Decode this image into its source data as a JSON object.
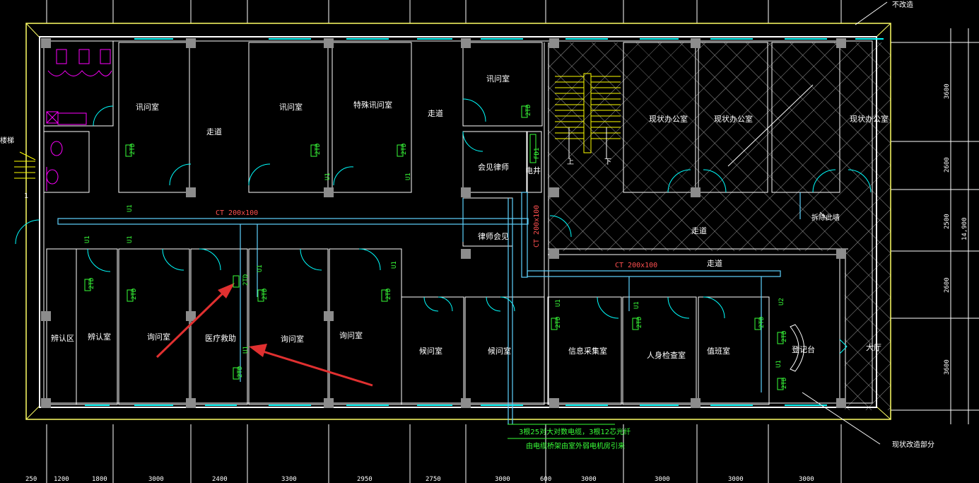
{
  "colors": {
    "wall": "#ffffff",
    "outline": "#ffff66",
    "cable": "#5fd3ff",
    "cable_label": "#ff5050",
    "terminal": "#39ff39",
    "door": "#00ffff",
    "hatch": "#9a9a9a",
    "column": "#8c8c8c",
    "toilet": "#ff00ff",
    "stair": "#ffff00",
    "arrow": "#e03030"
  },
  "labels": {
    "not_renovated": "不改造",
    "stair_left": "楼梯",
    "renovate_part": "现状改造部分",
    "demolish": "拆除此墙",
    "up": "上",
    "down": "下",
    "one": "1"
  },
  "rooms": {
    "interrogation_1": "讯问室",
    "corridor_1": "走道",
    "interrogation_2": "讯问室",
    "special_interrogation": "特殊讯问室",
    "corridor_2": "走道",
    "interrogation_3": "讯问室",
    "lawyer_meet": "会见律师",
    "elec_shaft": "电井",
    "lawyer_meeting": "律师会见",
    "office_1": "现状办公室",
    "office_2": "现状办公室",
    "office_3": "现状办公室",
    "corridor_3": "走道",
    "corridor_4": "走道",
    "identification_area": "辨认区",
    "identification_room": "辨认室",
    "inquiry_1": "询问室",
    "medical": "医疗救助",
    "inquiry_2": "询问室",
    "inquiry_3": "询问室",
    "waiting_1": "候问室",
    "waiting_2": "候问室",
    "info_collection": "信息采集室",
    "body_check": "人身检查室",
    "duty": "值班室",
    "reception": "登记台",
    "hall": "大厅"
  },
  "cables": {
    "tray_1": "CT 200x100",
    "tray_2": "CT 200x100",
    "tray_3": "CT 200x100"
  },
  "terminals": {
    "u1": "U1",
    "u2": "U2",
    "zd": "2TD",
    "fd": "FD1"
  },
  "notes": {
    "line_1": "3根25对大对数电缆，3根12芯光纤",
    "line_2": "由电缆桥架由室外弱电机房引来"
  },
  "dimensions": {
    "bottom": [
      "250",
      "1200",
      "1800",
      "3000",
      "2400",
      "3300",
      "2950",
      "2750",
      "3000",
      "600",
      "3000",
      "3000",
      "3000",
      "3000"
    ],
    "right": [
      "3600",
      "2600",
      "2500",
      "2600",
      "3600"
    ],
    "total": "14,900"
  }
}
